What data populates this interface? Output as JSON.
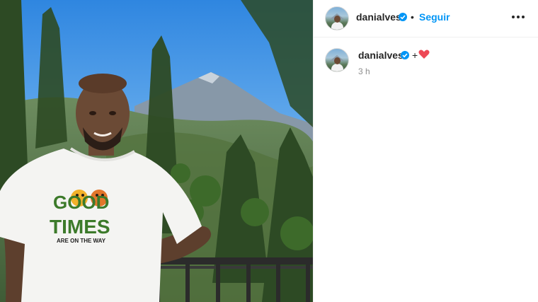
{
  "post": {
    "username": "danialves",
    "follow_label": "Seguir",
    "separator": "•",
    "caption_prefix": "+",
    "time_ago": "3 h"
  },
  "photo": {
    "shirt_line1": "GOOD",
    "shirt_line2": "TIMES",
    "shirt_line3": "ARE ON THE WAY"
  },
  "colors": {
    "accent": "#0095f6",
    "text": "#262626",
    "muted": "#8e8e8e",
    "heart": "#ed4956"
  },
  "icons": {
    "verified": "verified-badge-icon",
    "more": "more-options-icon",
    "heart": "heart-icon"
  }
}
